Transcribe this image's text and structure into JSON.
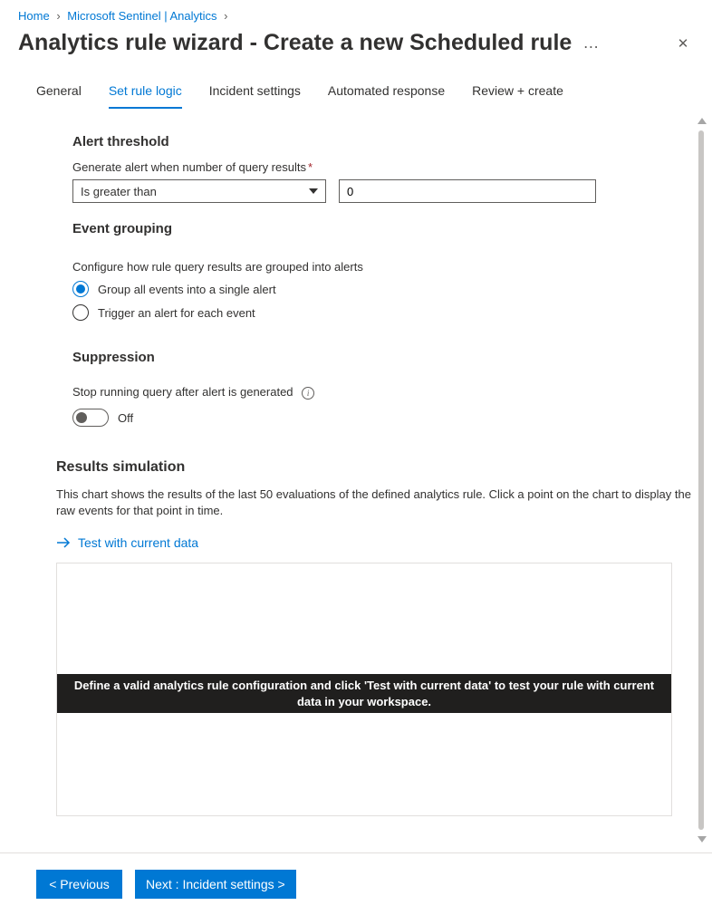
{
  "breadcrumb": {
    "home": "Home",
    "sentinel": "Microsoft Sentinel | Analytics"
  },
  "page_title": "Analytics rule wizard - Create a new Scheduled rule",
  "tabs": {
    "general": "General",
    "set_rule_logic": "Set rule logic",
    "incident_settings": "Incident settings",
    "automated_response": "Automated response",
    "review_create": "Review + create"
  },
  "alert_threshold": {
    "heading": "Alert threshold",
    "label": "Generate alert when number of query results",
    "operator": "Is greater than",
    "value": "0"
  },
  "event_grouping": {
    "heading": "Event grouping",
    "desc": "Configure how rule query results are grouped into alerts",
    "opt1": "Group all events into a single alert",
    "opt2": "Trigger an alert for each event"
  },
  "suppression": {
    "heading": "Suppression",
    "label": "Stop running query after alert is generated",
    "state": "Off"
  },
  "results_sim": {
    "heading": "Results simulation",
    "desc": "This chart shows the results of the last 50 evaluations of the defined analytics rule. Click a point on the chart to display the raw events for that point in time.",
    "test_link": "Test with current data",
    "banner": "Define a valid analytics rule configuration and click 'Test with current data' to test your rule with current data in your workspace."
  },
  "footer": {
    "prev": "< Previous",
    "next": "Next : Incident settings >"
  }
}
